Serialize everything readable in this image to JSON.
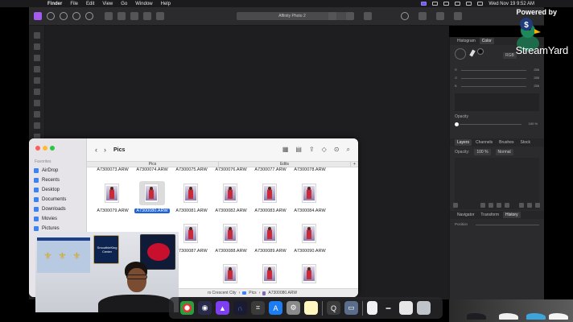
{
  "menubar": {
    "apple": "",
    "items": [
      "Finder",
      "File",
      "Edit",
      "View",
      "Go",
      "Window",
      "Help"
    ],
    "clock": "Wed Nov 19  9:52 AM"
  },
  "affinity": {
    "window_title": "Affinity Photo 2",
    "color_panel": {
      "tabs": [
        "Histogram",
        "Color"
      ],
      "mode": "RGB",
      "channels": [
        {
          "label": "R",
          "value": "255"
        },
        {
          "label": "G",
          "value": "255"
        },
        {
          "label": "B",
          "value": "255"
        }
      ],
      "opacity_label": "Opacity",
      "opacity_value": "100 %"
    },
    "layers_panel": {
      "tabs": [
        "Layers",
        "Channels",
        "Brushes",
        "Stock"
      ],
      "opacity_label": "Opacity:",
      "opacity_value": "100 %",
      "blend_mode": "Normal"
    },
    "history_panel": {
      "tabs": [
        "Navigator",
        "Transform",
        "History"
      ],
      "position_label": "Position"
    }
  },
  "streamyard": {
    "powered_by": "Powered by",
    "brand": "StreamYard"
  },
  "finder": {
    "title": "Pics",
    "sidebar": {
      "section": "Favorites",
      "items": [
        "AirDrop",
        "Recents",
        "Desktop",
        "Documents",
        "Downloads",
        "Movies",
        "Pictures"
      ]
    },
    "tabs": [
      "Pics",
      "Edits"
    ],
    "files_row_labels_only": [
      "A7300073.ARW",
      "A7300074.ARW",
      "A7300075.ARW",
      "A7300076.ARW",
      "A7300077.ARW",
      "A7300078.ARW"
    ],
    "files_row2": [
      "A7300079.ARW",
      "A7300080.ARW",
      "A7300081.ARW",
      "A7300082.ARW",
      "A7300083.ARW",
      "A7300084.ARW"
    ],
    "files_row3": [
      "",
      "",
      "A7300087.ARW",
      "A7300088.ARW",
      "A7300089.ARW",
      "A7300090.ARW"
    ],
    "selected_file": "A7300080.ARW",
    "path_bar": [
      "rs Crescent City",
      "Pics",
      "A7300080.ARW"
    ],
    "path_sep": "›"
  },
  "webcam": {
    "banner_text": "SmoothieKing Center"
  },
  "colors": {
    "selection": "#1d63d6",
    "affinity_accent": "#a45cf0",
    "finder_bg": "#f6f6f6",
    "dark_ui": "#2b2b2d"
  }
}
